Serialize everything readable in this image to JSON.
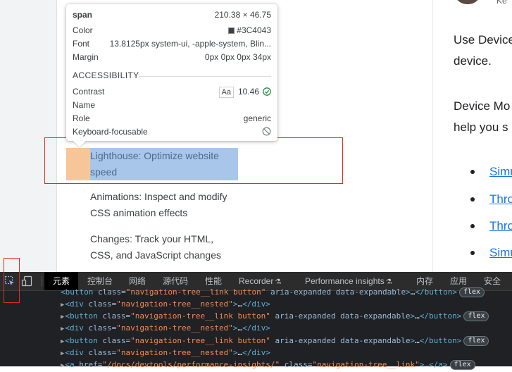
{
  "sidebar_nav": {
    "item_lighthouse_l1": "Lighthouse: Optimize website",
    "item_lighthouse_l2": "speed",
    "item_animations_l1": "Animations: Inspect and modify",
    "item_animations_l2": "CSS animation effects",
    "item_changes_l1": "Changes: Track your HTML,",
    "item_changes_l2": "CSS, and JavaScript changes"
  },
  "inspect_tooltip": {
    "tag": "span",
    "dimensions": "210.38 × 46.75",
    "color_label": "Color",
    "color_value": "#3C4043",
    "font_label": "Font",
    "font_value": "13.8125px system-ui, -apple-system, Blin...",
    "margin_label": "Margin",
    "margin_value": "0px 0px 0px 34px",
    "accessibility_heading": "ACCESSIBILITY",
    "contrast_label": "Contrast",
    "contrast_aa": "Aa",
    "contrast_value": "10.46",
    "name_label": "Name",
    "name_value": "",
    "role_label": "Role",
    "role_value": "generic",
    "keyboard_label": "Keyboard-focusable"
  },
  "right_content": {
    "p1_l1": "Use Device",
    "p1_l2": "device.",
    "p2_l1": "Device Mo",
    "p2_l2": "help you s",
    "links": [
      "Simu",
      "Thro",
      "Thro",
      "Simu"
    ],
    "avatar_fragment": "Ke"
  },
  "devtools": {
    "tabs": [
      {
        "label": "元素",
        "active": true
      },
      {
        "label": "控制台"
      },
      {
        "label": "网络"
      },
      {
        "label": "源代码"
      },
      {
        "label": "性能"
      },
      {
        "label": "Recorder"
      },
      {
        "label": "Performance insights"
      },
      {
        "label": "内存"
      },
      {
        "label": "应用"
      },
      {
        "label": "安全"
      }
    ],
    "dom": {
      "button_attr_name": "class",
      "button_class": "\"navigation-tree__link button\"",
      "button_extra_attrs": "aria-expanded data-expandable",
      "div_class": "\"navigation-tree__nested\"",
      "anchor_href": "\"/docs/devtools/performance-insights/\"",
      "anchor_class": "\"navigation-tree__link\"",
      "badge": "flex"
    }
  },
  "colors": {
    "margin_highlight": "#f6c18f",
    "content_highlight": "#a8c6ea",
    "red_annotation": "#d93025",
    "tag_purple": "#881280",
    "contrast_pass": "#1e8e3e"
  }
}
